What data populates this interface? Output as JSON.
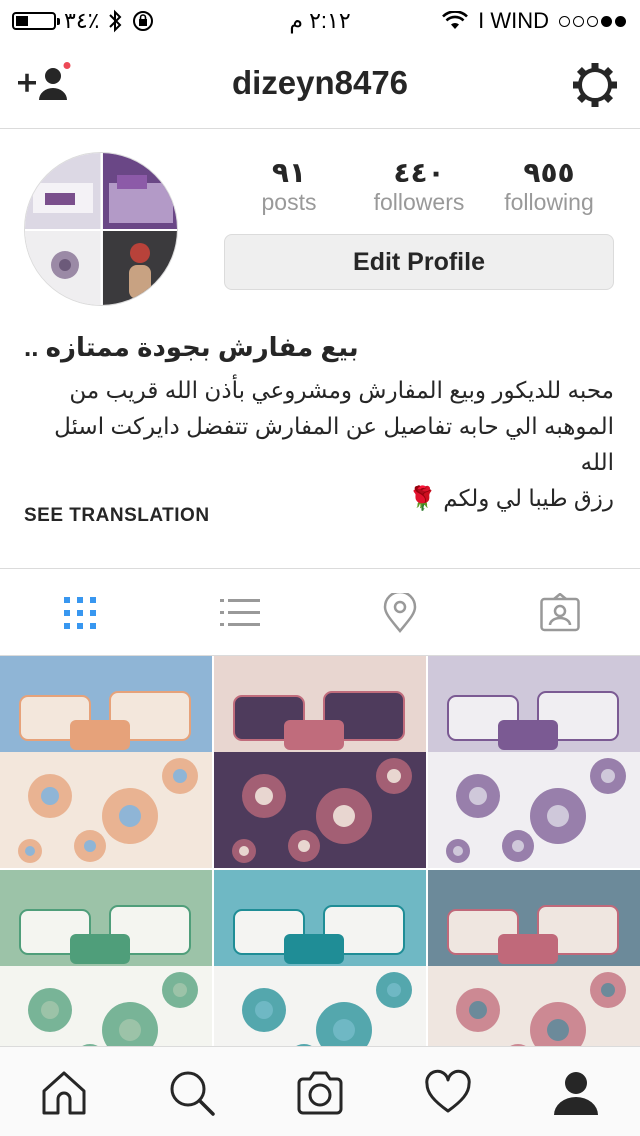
{
  "status_bar": {
    "battery_percent": "٣٤٪",
    "battery_level": 0.34,
    "time": "٢:١٢ م",
    "carrier": "I WIND"
  },
  "nav": {
    "username": "dizeyn8476"
  },
  "profile": {
    "stats": [
      {
        "value": "٩١",
        "label": "posts"
      },
      {
        "value": "٤٤٠",
        "label": "followers"
      },
      {
        "value": "٩٥٥",
        "following": true,
        "label": "following"
      }
    ],
    "edit_button": "Edit Profile",
    "bio_name": "بيع مفارش بجودة  ممتازه ..",
    "bio_lines": [
      "محبه للديكور وبيع المفارش ومشروعي بأذن الله قريب من",
      "الموهبه الي حابه تفاصيل عن المفارش تتفضل دايركت اسئل الله",
      "رزق طيبا لي ولكم"
    ],
    "bio_emoji": "🌹",
    "see_translation": "SEE TRANSLATION"
  },
  "tabs": [
    {
      "icon": "grid-icon",
      "active": true
    },
    {
      "icon": "list-icon",
      "active": false
    },
    {
      "icon": "location-pin-icon",
      "active": false
    },
    {
      "icon": "tagged-person-icon",
      "active": false
    }
  ],
  "posts": [
    {
      "palette": [
        "#f3e7dc",
        "#e6a27a",
        "#8fb5d6"
      ]
    },
    {
      "palette": [
        "#4e3b5c",
        "#c06c7c",
        "#e8d6d0"
      ]
    },
    {
      "palette": [
        "#f0eef2",
        "#7b5a93",
        "#cfc8da"
      ]
    },
    {
      "palette": [
        "#f4f5f0",
        "#4f9e7a",
        "#9cc3a8"
      ]
    },
    {
      "palette": [
        "#f4f4f2",
        "#1f8d96",
        "#6fb8c4"
      ]
    },
    {
      "palette": [
        "#efe6e0",
        "#c0697a",
        "#6c8a9a"
      ]
    }
  ],
  "colors": {
    "accent": "#3897f0",
    "notification_dot": "#ed4956",
    "text": "#262626",
    "muted": "#999999",
    "border": "#dbdbdb"
  }
}
